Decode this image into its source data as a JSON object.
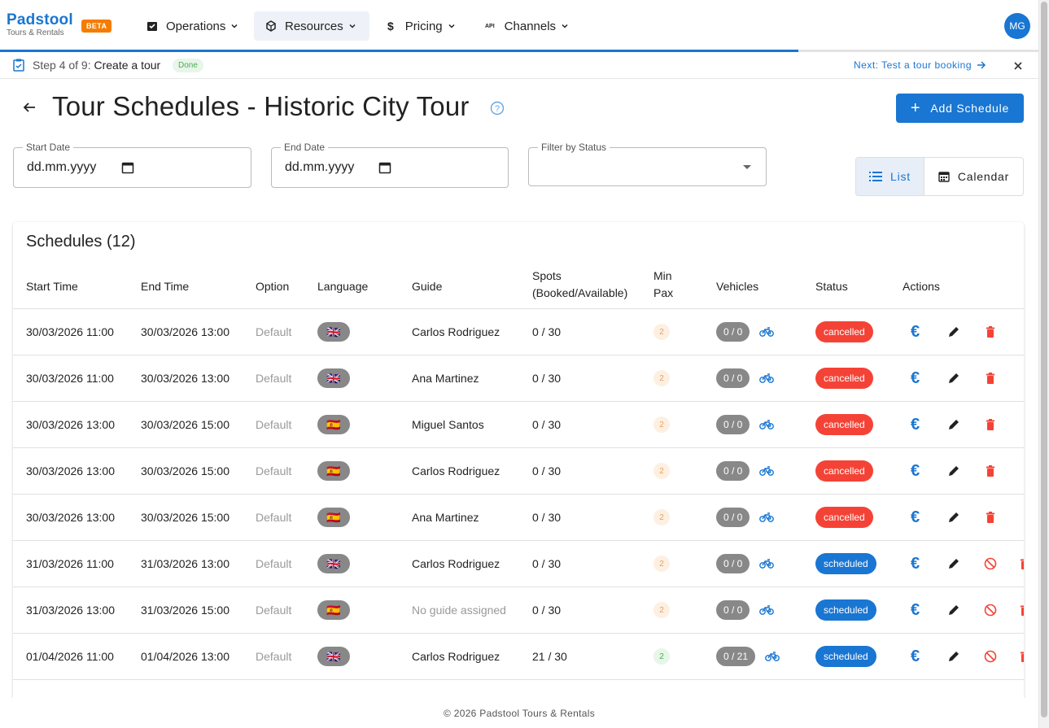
{
  "app": {
    "name": "Padstool",
    "sub": "Tours & Rentals",
    "beta": "BETA",
    "avatar": "MG"
  },
  "nav": [
    {
      "label": "Operations",
      "icon": "clipboard-icon"
    },
    {
      "label": "Resources",
      "icon": "cube-icon"
    },
    {
      "label": "Pricing",
      "icon": "dollar-icon"
    },
    {
      "label": "Channels",
      "icon": "api-icon"
    }
  ],
  "step": {
    "prefix": "Step 4 of 9:",
    "name": "Create a tour",
    "badge": "Done",
    "next": "Next: Test a tour booking"
  },
  "page": {
    "title": "Tour Schedules - Historic City Tour",
    "add_label": "Add Schedule"
  },
  "filters": {
    "start_label": "Start Date",
    "start_value": "dd.mm.yyyy",
    "end_label": "End Date",
    "end_value": "dd.mm.yyyy",
    "status_label": "Filter by Status",
    "status_value": ""
  },
  "view": {
    "list": "List",
    "calendar": "Calendar"
  },
  "table": {
    "title": "Schedules (12)",
    "headers": [
      "Start Time",
      "End Time",
      "Option",
      "Language",
      "Guide",
      "Spots\n(Booked/Available)",
      "Min\nPax",
      "Vehicles",
      "Status",
      "Actions"
    ],
    "rows": [
      {
        "start": "30/03/2026 11:00",
        "end": "30/03/2026 13:00",
        "option": "Default",
        "lang": "🇬🇧",
        "guide": "Carlos Rodriguez",
        "spots": "0 / 30",
        "minpax": "2",
        "veh": "0 / 0",
        "status": "cancelled"
      },
      {
        "start": "30/03/2026 11:00",
        "end": "30/03/2026 13:00",
        "option": "Default",
        "lang": "🇬🇧",
        "guide": "Ana Martinez",
        "spots": "0 / 30",
        "minpax": "2",
        "veh": "0 / 0",
        "status": "cancelled"
      },
      {
        "start": "30/03/2026 13:00",
        "end": "30/03/2026 15:00",
        "option": "Default",
        "lang": "🇪🇸",
        "guide": "Miguel Santos",
        "spots": "0 / 30",
        "minpax": "2",
        "veh": "0 / 0",
        "status": "cancelled"
      },
      {
        "start": "30/03/2026 13:00",
        "end": "30/03/2026 15:00",
        "option": "Default",
        "lang": "🇪🇸",
        "guide": "Carlos Rodriguez",
        "spots": "0 / 30",
        "minpax": "2",
        "veh": "0 / 0",
        "status": "cancelled"
      },
      {
        "start": "30/03/2026 13:00",
        "end": "30/03/2026 15:00",
        "option": "Default",
        "lang": "🇪🇸",
        "guide": "Ana Martinez",
        "spots": "0 / 30",
        "minpax": "2",
        "veh": "0 / 0",
        "status": "cancelled"
      },
      {
        "start": "31/03/2026 11:00",
        "end": "31/03/2026 13:00",
        "option": "Default",
        "lang": "🇬🇧",
        "guide": "Carlos Rodriguez",
        "spots": "0 / 30",
        "minpax": "2",
        "veh": "0 / 0",
        "status": "scheduled"
      },
      {
        "start": "31/03/2026 13:00",
        "end": "31/03/2026 15:00",
        "option": "Default",
        "lang": "🇪🇸",
        "guide": "No guide assigned",
        "spots": "0 / 30",
        "minpax": "2",
        "veh": "0 / 0",
        "status": "scheduled"
      },
      {
        "start": "01/04/2026 11:00",
        "end": "01/04/2026 13:00",
        "option": "Default",
        "lang": "🇬🇧",
        "guide": "Carlos Rodriguez",
        "spots": "21 / 30",
        "minpax": "2",
        "veh": "0 / 21",
        "status": "scheduled"
      }
    ]
  },
  "footer": "© 2026 Padstool Tours & Rentals"
}
